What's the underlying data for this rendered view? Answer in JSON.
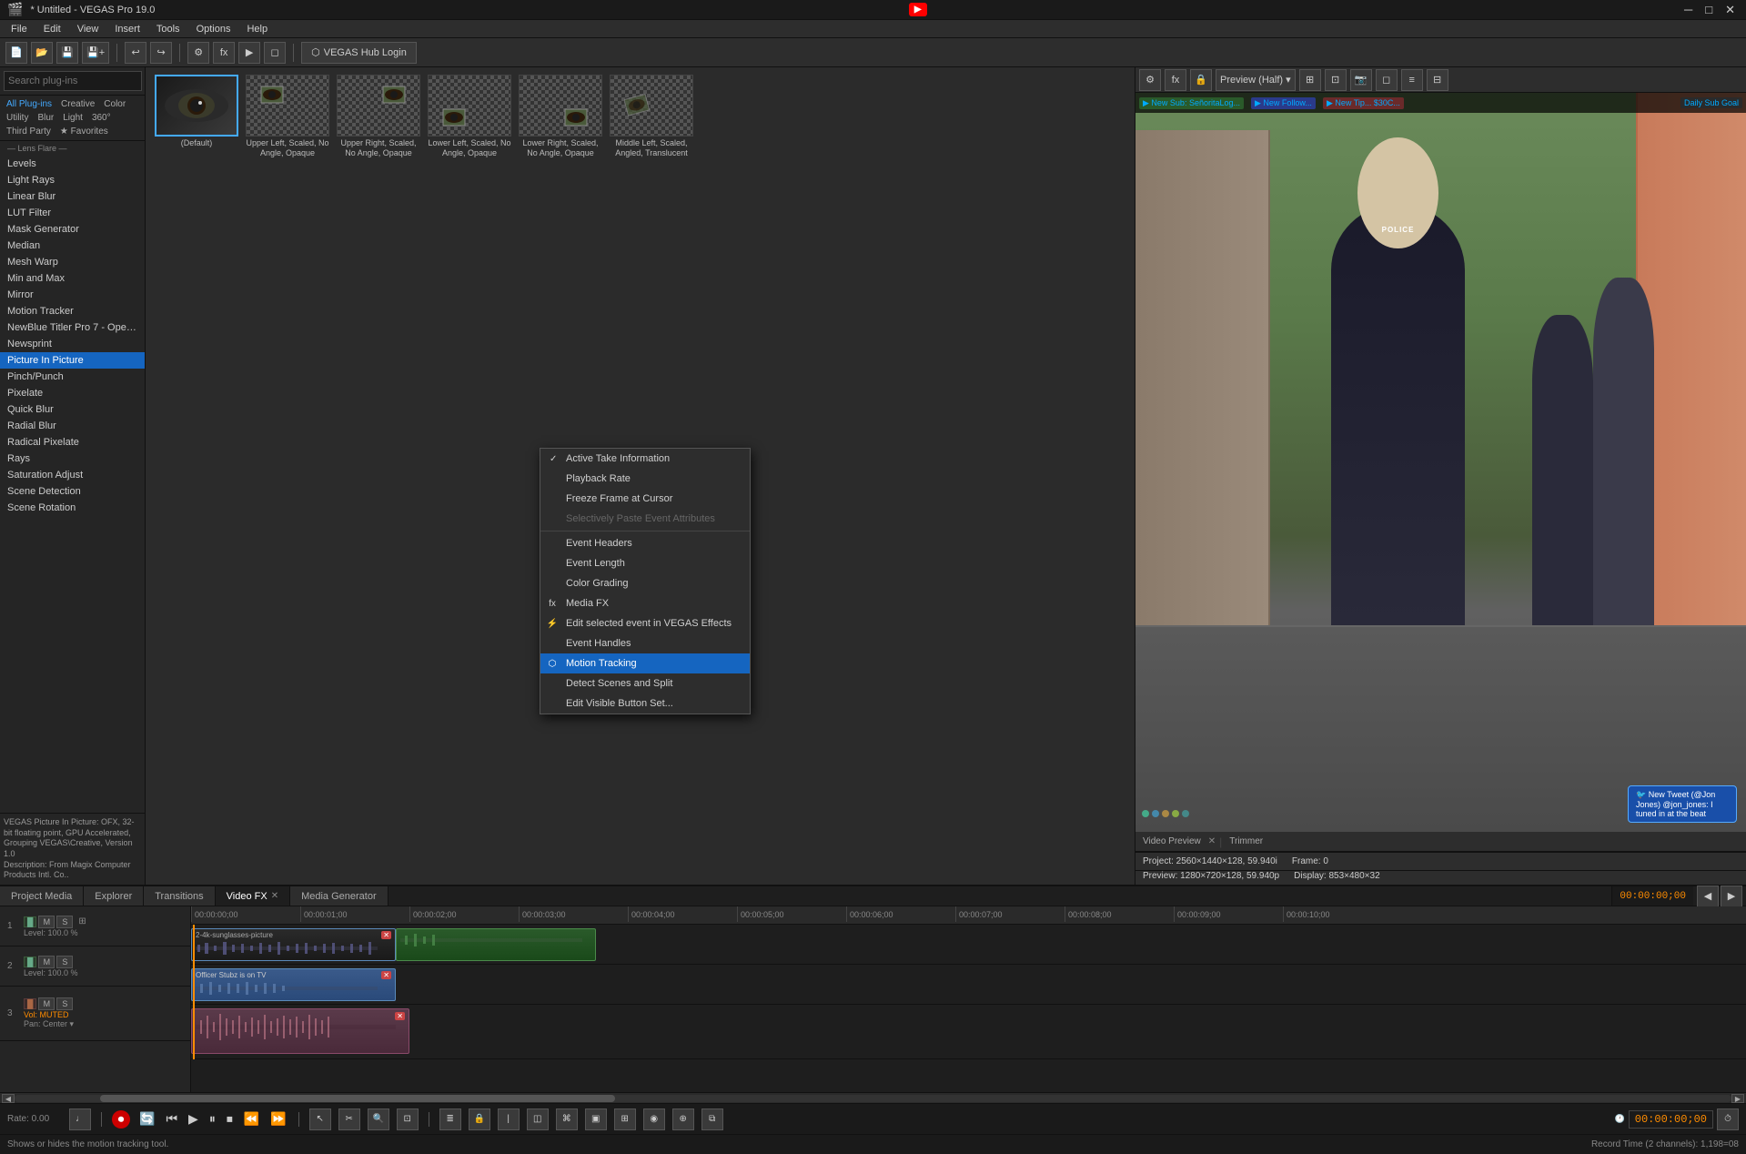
{
  "titleBar": {
    "title": "* Untitled - VEGAS Pro 19.0",
    "youtubeLabel": "▶",
    "controls": [
      "─",
      "□",
      "✕"
    ]
  },
  "menuBar": {
    "items": [
      "File",
      "Edit",
      "View",
      "Insert",
      "Tools",
      "Options",
      "Help"
    ]
  },
  "toolbar": {
    "hubBtn": "VEGAS Hub Login"
  },
  "pluginPanel": {
    "searchPlaceholder": "Search plug-ins",
    "tabs": [
      "All Plug-ins",
      "Creative",
      "Color",
      "Utility",
      "Blur",
      "Light",
      "360°",
      "Third Party",
      "★ Favorites"
    ],
    "items": [
      {
        "label": "Levels",
        "selected": false
      },
      {
        "label": "Light Rays",
        "selected": false
      },
      {
        "label": "Linear Blur",
        "selected": false
      },
      {
        "label": "LUT Filter",
        "selected": false
      },
      {
        "label": "Mask Generator",
        "selected": false
      },
      {
        "label": "Median",
        "selected": false
      },
      {
        "label": "Mesh Warp",
        "selected": false
      },
      {
        "label": "Min and Max",
        "selected": false
      },
      {
        "label": "Mirror",
        "selected": false
      },
      {
        "label": "Motion Tracker",
        "selected": false
      },
      {
        "label": "NewBlue Titler Pro 7 - OpenFX",
        "selected": false
      },
      {
        "label": "Newsprint",
        "selected": false
      },
      {
        "label": "Picture In Picture",
        "selected": true
      },
      {
        "label": "Pinch/Punch",
        "selected": false
      },
      {
        "label": "Pixelate",
        "selected": false
      },
      {
        "label": "Quick Blur",
        "selected": false
      },
      {
        "label": "Radial Blur",
        "selected": false
      },
      {
        "label": "Radical Pixelate",
        "selected": false
      },
      {
        "label": "Rays",
        "selected": false
      },
      {
        "label": "Saturation Adjust",
        "selected": false
      },
      {
        "label": "Scene Detection",
        "selected": false
      },
      {
        "label": "Scene Rotation",
        "selected": false
      }
    ],
    "description": "VEGAS Picture In Picture: OFX, 32-bit floating point, GPU Accelerated, Grouping VEGAS\\Creative, Version 1.0\nDescription: From Magix Computer Products Intl. Co.."
  },
  "effectsGrid": {
    "items": [
      {
        "label": "(Default)",
        "selected": true
      },
      {
        "label": "Upper Left, Scaled, No Angle, Opaque"
      },
      {
        "label": "Upper Right, Scaled, No Angle, Opaque"
      },
      {
        "label": "Lower Left, Scaled, No Angle, Opaque"
      },
      {
        "label": "Lower Right, Scaled, No Angle, Opaque"
      },
      {
        "label": "Middle Left, Scaled, Angled, Translucent"
      }
    ]
  },
  "previewPanel": {
    "title": "Preview (Half)",
    "project": "Project: 2560×1440×128, 59.940i",
    "preview": "Preview: 1280×720×128, 59.940p",
    "frame": "Frame: 0",
    "display": "Display: 853×480×32",
    "videoPreview": "Video Preview",
    "trimmer": "Trimmer",
    "notificationText": "New Tweet (@Jon Jones) @jon_jones: I tuned in at the beat"
  },
  "timeline": {
    "tabs": [
      "Project Media",
      "Explorer",
      "Transitions",
      "Video FX",
      "Media Generator"
    ],
    "activeTab": "Video FX",
    "timeMarkers": [
      "00:00:00;00",
      "00:00:01;00",
      "00:00:02;00",
      "00:00:03;00",
      "00:00:04;00",
      "00:00:05;00",
      "00:00:06;00",
      "00:00:07;00",
      "00:00:08;00",
      "00:00:09;00",
      "00:00:10;00"
    ],
    "currentTime": "00:00:00;00",
    "tracks": [
      {
        "num": "1",
        "type": "video",
        "controls": [
          "M",
          "S"
        ],
        "level": "Level: 100.0 %",
        "clip": "2-4k-sunglasses-picture"
      },
      {
        "num": "2",
        "type": "video",
        "controls": [
          "M",
          "S"
        ],
        "level": "Level: 100.0 %",
        "clip": "Officer Stubz is on TV"
      },
      {
        "num": "3",
        "type": "audio",
        "controls": [
          "M",
          "S"
        ],
        "level": "Vol: MUTED",
        "pan": "Pan: Center"
      }
    ]
  },
  "contextMenu": {
    "items": [
      {
        "label": "Active Take Information",
        "checked": true,
        "id": "active-take"
      },
      {
        "label": "Playback Rate",
        "checked": false,
        "id": "playback-rate"
      },
      {
        "label": "Freeze Frame at Cursor",
        "checked": false,
        "id": "freeze-frame"
      },
      {
        "label": "Selectively Paste Event Attributes",
        "disabled": true,
        "id": "paste-attrs"
      },
      {
        "label": "separator"
      },
      {
        "label": "Event Headers",
        "id": "event-headers"
      },
      {
        "label": "Event Length",
        "id": "event-length"
      },
      {
        "label": "Color Grading",
        "id": "color-grading"
      },
      {
        "label": "Media FX",
        "id": "media-fx",
        "hasIcon": true
      },
      {
        "label": "Edit selected event in VEGAS Effects",
        "id": "edit-effects",
        "hasIcon": true
      },
      {
        "label": "Event Handles",
        "id": "event-handles"
      },
      {
        "label": "Motion Tracking",
        "id": "motion-tracking",
        "highlighted": true
      },
      {
        "label": "Detect Scenes and Split",
        "id": "detect-scenes"
      },
      {
        "label": "Edit Visible Button Set...",
        "id": "edit-button-set"
      }
    ]
  },
  "statusBar": {
    "rate": "Rate: 0.00",
    "bottomText": "Shows or hides the motion tracking tool.",
    "recordTime": "Record Time (2 channels): 1,198=08"
  },
  "transport": {
    "buttons": [
      "record",
      "loop",
      "play-back",
      "play",
      "pause",
      "stop",
      "prev",
      "next",
      "ff",
      "rw",
      "snap"
    ]
  }
}
